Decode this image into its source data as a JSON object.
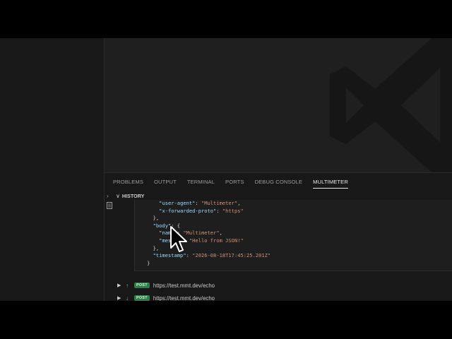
{
  "panel": {
    "tabs": [
      {
        "label": "PROBLEMS"
      },
      {
        "label": "OUTPUT"
      },
      {
        "label": "TERMINAL"
      },
      {
        "label": "PORTS"
      },
      {
        "label": "DEBUG CONSOLE"
      },
      {
        "label": "MULTIMETER",
        "active": true
      }
    ]
  },
  "history": {
    "section_label": "HISTORY",
    "code": {
      "user_agent_key": "\"user-agent\"",
      "user_agent_value": "\"Multimeter\"",
      "xfp_key": "\"x-forwarded-proto\"",
      "xfp_value": "\"https\"",
      "body_key": "\"body\"",
      "name_key": "\"name\"",
      "name_value": "\"Multimeter\"",
      "message_key": "\"messa",
      "message_value": "\"Hello from JSON!\"",
      "timestamp_key": "\"timestamp\"",
      "timestamp_value": "\"2026-08-18T17:45:25.201Z\""
    },
    "requests": [
      {
        "method": "POST",
        "direction_icon": "arrow-up-icon",
        "url": "https://test.mmt.dev/echo"
      },
      {
        "method": "POST",
        "direction_icon": "arrow-down-icon",
        "url": "https://test.mmt.dev/echo"
      }
    ]
  },
  "colors": {
    "accent_post": "#2e7d4a",
    "json_key": "#9cdcfe",
    "json_string": "#ce9178"
  }
}
